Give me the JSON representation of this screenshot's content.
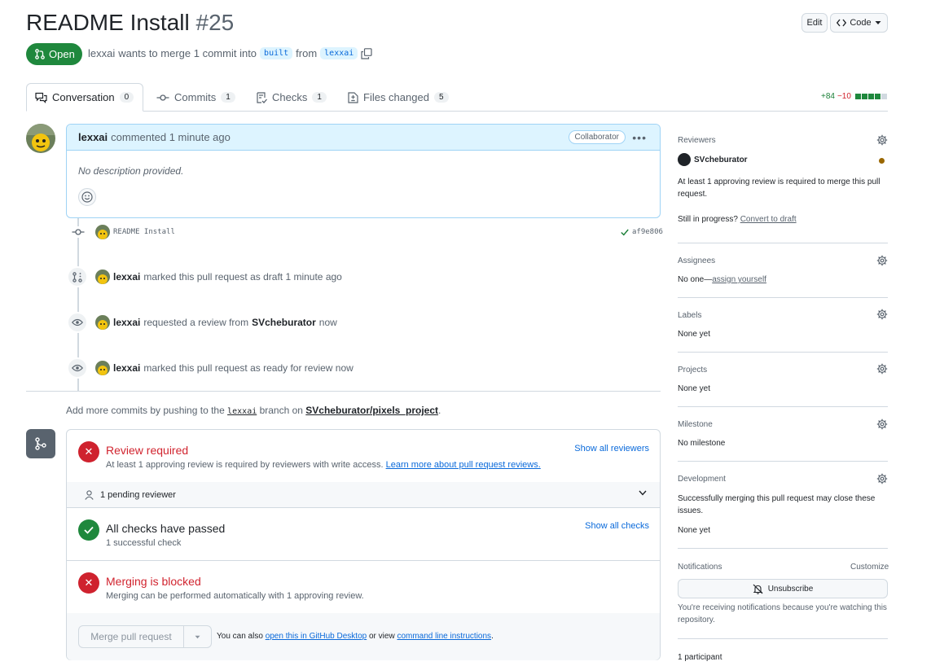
{
  "pr": {
    "title": "README Install",
    "number": "#25",
    "state": "Open",
    "author": "lexxai",
    "summary_mid": "wants to merge 1 commit into",
    "base_branch": "built",
    "from_word": "from",
    "head_branch": "lexxai"
  },
  "header_buttons": {
    "edit": "Edit",
    "code": "Code"
  },
  "tabs": [
    {
      "label": "Conversation",
      "count": "0"
    },
    {
      "label": "Commits",
      "count": "1"
    },
    {
      "label": "Checks",
      "count": "1"
    },
    {
      "label": "Files changed",
      "count": "5"
    }
  ],
  "diffstat": {
    "additions": "+84",
    "deletions": "−10"
  },
  "comment": {
    "author": "lexxai",
    "action": "commented 1 minute ago",
    "badge": "Collaborator",
    "body": "No description provided."
  },
  "timeline": {
    "commit": {
      "message": "README Install",
      "sha": "af9e806"
    },
    "events": [
      {
        "actor": "lexxai",
        "text": "marked this pull request as draft 1 minute ago",
        "extra": ""
      },
      {
        "actor": "lexxai",
        "text": "requested a review from",
        "target": "SVcheburator",
        "time": "now"
      },
      {
        "actor": "lexxai",
        "text": "marked this pull request as ready for review now"
      }
    ]
  },
  "push_hint": {
    "prefix": "Add more commits by pushing to the",
    "branch": "lexxai",
    "middle": "branch on",
    "repo": "SVcheburator/pixels_project",
    "suffix": "."
  },
  "merge_box": {
    "review": {
      "title": "Review required",
      "desc": "At least 1 approving review is required by reviewers with write access.",
      "desc_link": "Learn more about pull request reviews.",
      "action": "Show all reviewers"
    },
    "pending": "1 pending reviewer",
    "checks": {
      "title": "All checks have passed",
      "desc": "1 successful check",
      "action": "Show all checks"
    },
    "blocked": {
      "title": "Merging is blocked",
      "desc": "Merging can be performed automatically with 1 approving review."
    },
    "merge_button": "Merge pull request",
    "alt_prefix": "You can also",
    "alt_link1": "open this in GitHub Desktop",
    "alt_mid": "or view",
    "alt_link2": "command line instructions",
    "alt_suffix": "."
  },
  "sidebar": {
    "reviewers": {
      "title": "Reviewers",
      "name": "SVcheburator",
      "note": "At least 1 approving review is required to merge this pull request.",
      "progress_prefix": "Still in progress?",
      "progress_link": "Convert to draft"
    },
    "assignees": {
      "title": "Assignees",
      "prefix": "No one—",
      "link": "assign yourself"
    },
    "labels": {
      "title": "Labels",
      "value": "None yet"
    },
    "projects": {
      "title": "Projects",
      "value": "None yet"
    },
    "milestone": {
      "title": "Milestone",
      "value": "No milestone"
    },
    "development": {
      "title": "Development",
      "note": "Successfully merging this pull request may close these issues.",
      "value": "None yet"
    },
    "notifications": {
      "title": "Notifications",
      "customize": "Customize",
      "button": "Unsubscribe",
      "note": "You're receiving notifications because you're watching this repository."
    },
    "participants": "1 participant"
  },
  "colors": {
    "open_green": "#1f883d",
    "danger": "#cf222e",
    "accent": "#0969da",
    "pending_dot": "#9a6700"
  }
}
